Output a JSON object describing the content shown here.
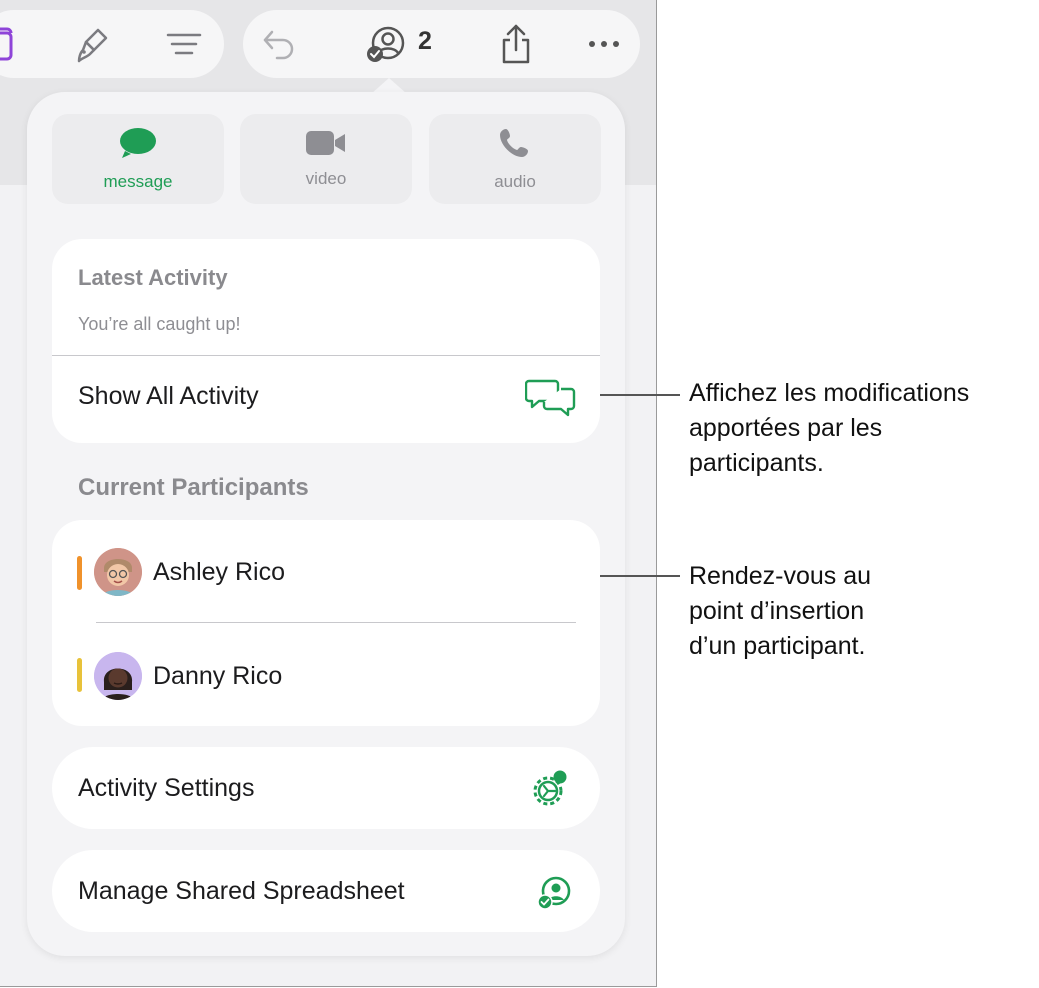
{
  "toolbar": {
    "participant_count": "2",
    "icons": [
      "document-icon",
      "paintbrush-icon",
      "format-icon",
      "undo-icon",
      "collaboration-icon",
      "share-icon",
      "more-icon"
    ]
  },
  "communication": [
    {
      "label": "message",
      "icon": "message-bubble-icon",
      "active": true
    },
    {
      "label": "video",
      "icon": "video-camera-icon",
      "active": false
    },
    {
      "label": "audio",
      "icon": "phone-icon",
      "active": false
    }
  ],
  "activity": {
    "title": "Latest Activity",
    "status": "You’re all caught up!",
    "show_all_label": "Show All Activity"
  },
  "participants": {
    "title": "Current Participants",
    "items": [
      {
        "name": "Ashley Rico",
        "color": "#f0922b"
      },
      {
        "name": "Danny Rico",
        "color": "#e8c23a"
      }
    ]
  },
  "settings": {
    "activity_settings_label": "Activity Settings",
    "manage_label": "Manage Shared Spreadsheet"
  },
  "callouts": {
    "first": [
      "Affichez les modifications",
      "apportées par les",
      "participants."
    ],
    "second": [
      "Rendez-vous au",
      "point d’insertion",
      "d’un participant."
    ]
  },
  "colors": {
    "accent_green": "#1f9d55",
    "muted_gray": "#8e8e93"
  }
}
